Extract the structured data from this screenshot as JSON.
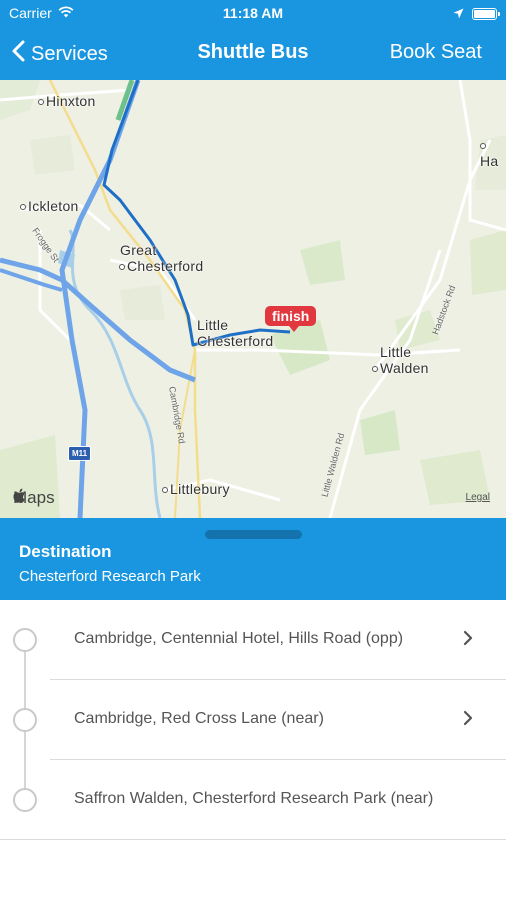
{
  "status_bar": {
    "carrier": "Carrier",
    "time": "11:18 AM",
    "icons": [
      "wifi-icon",
      "location-arrow-icon",
      "battery-icon"
    ]
  },
  "nav": {
    "back_label": "Services",
    "title": "Shuttle Bus",
    "right_action": "Book Seat"
  },
  "map": {
    "places": {
      "hinxton": "Hinxton",
      "ickleton": "Ickleton",
      "great_chesterford_1": "Great",
      "great_chesterford_2": "Chesterford",
      "little_chesterford_1": "Little",
      "little_chesterford_2": "Chesterford",
      "little_walden_1": "Little",
      "little_walden_2": "Walden",
      "littlebury": "Littlebury",
      "ha": "Ha"
    },
    "roads": {
      "frogge": "Frogge St",
      "cambridge_rd": "Cambridge Rd",
      "little_walden_rd": "Little Walden Rd",
      "hadstock_rd": "Hadstock Rd",
      "m11": "M11"
    },
    "finish_label": "finish",
    "attribution": "Maps",
    "legal": "Legal",
    "colors": {
      "route": "#1f6fc7",
      "motorway": "#6fa5e8",
      "land": "#eef0e4",
      "park": "#d7e8c7"
    }
  },
  "destination": {
    "heading": "Destination",
    "name": "Chesterford Research Park"
  },
  "stops": [
    {
      "name": "Cambridge, Centennial Hotel, Hills Road (opp)",
      "has_chevron": true
    },
    {
      "name": "Cambridge, Red Cross Lane (near)",
      "has_chevron": true
    },
    {
      "name": "Saffron Walden, Chesterford Research Park (near)",
      "has_chevron": false
    }
  ],
  "accent_color": "#1a96e0"
}
